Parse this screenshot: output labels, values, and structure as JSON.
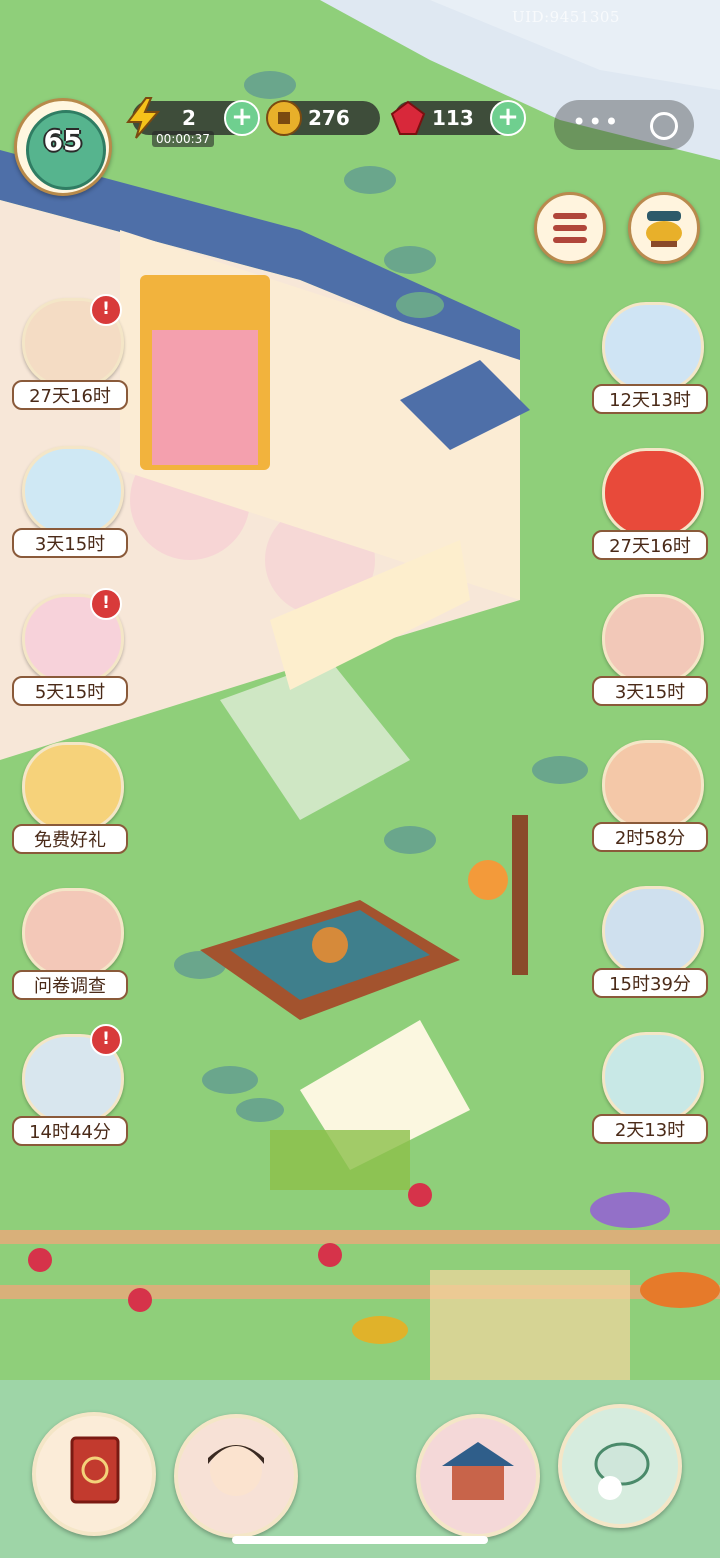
{
  "uid": "UID:9451305",
  "hud": {
    "level": "65",
    "energy": "2",
    "energy_timer": "00:00:37",
    "coins": "276",
    "gems": "113"
  },
  "left_events": [
    {
      "label": "27天16时",
      "icon": "scroll-box-icon",
      "alert": true
    },
    {
      "label": "3天15时",
      "icon": "fox-cat-icon",
      "alert": false
    },
    {
      "label": "5天15时",
      "icon": "fabric-flower-icon",
      "alert": true
    },
    {
      "label": "免费好礼",
      "icon": "gift-emblem-icon",
      "alert": false
    },
    {
      "label": "问卷调查",
      "icon": "questionnaire-scroll-icon",
      "alert": false
    },
    {
      "label": "14时44分",
      "icon": "character-portrait-icon",
      "alert": true
    }
  ],
  "right_events": [
    {
      "label": "12天13时",
      "icon": "husky-dog-icon"
    },
    {
      "label": "27天16时",
      "icon": "fan-and-gifts-icon"
    },
    {
      "label": "3天15时",
      "icon": "lucky-cat-icon"
    },
    {
      "label": "2时58分",
      "icon": "treasure-pot-icon"
    },
    {
      "label": "15时39分",
      "icon": "one-plus-one-icon"
    },
    {
      "label": "2天13时",
      "icon": "cat-gift-box-icon"
    }
  ],
  "colors": {
    "grass": "#8fcf7a",
    "courtyard": "#f7e7d8",
    "wall_tile": "#4e6fa8",
    "label_border": "#8a5a3a",
    "alert": "#d83a3a"
  }
}
